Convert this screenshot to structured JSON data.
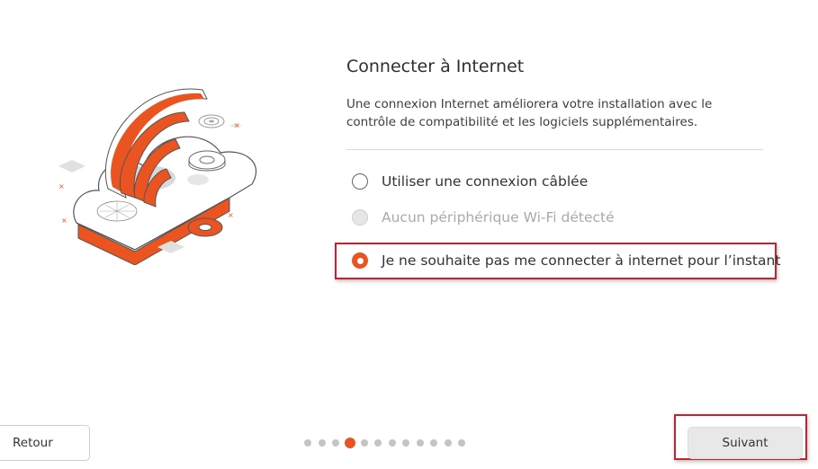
{
  "page": {
    "title": "Connecter à Internet",
    "description": "Une connexion Internet améliorera votre installation avec le contrôle de compatibilité et les logiciels supplémentaires."
  },
  "options": [
    {
      "label": "Utiliser une connexion câblée",
      "state": "unchecked"
    },
    {
      "label": "Aucun périphérique Wi-Fi détecté",
      "state": "disabled"
    },
    {
      "label": "Je ne souhaite pas me connecter à internet pour l’instant",
      "state": "checked"
    }
  ],
  "footer": {
    "back_label": "Retour",
    "next_label": "Suivant",
    "step_current": 4,
    "step_total": 12
  },
  "colors": {
    "accent": "#e95420",
    "highlight_border": "#cc1f2d",
    "disabled_text": "#aaaaaa"
  },
  "icons": {
    "illustration": "cloud-wifi-illustration"
  }
}
